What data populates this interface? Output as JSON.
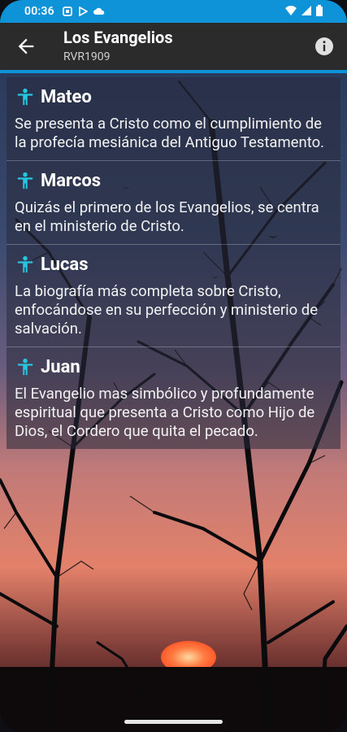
{
  "status": {
    "time": "00:36",
    "left_icons": [
      "card-icon",
      "play-store-icon",
      "cloud-icon"
    ],
    "right_icons": [
      "wifi-icon",
      "signal-icon",
      "battery-icon"
    ]
  },
  "appbar": {
    "title": "Los Evangelios",
    "subtitle": "RVR1909",
    "back_icon": "arrow-left-icon",
    "info_icon": "info-icon"
  },
  "gospels": [
    {
      "name": "Mateo",
      "description": "Se presenta a Cristo como el cumplimiento de la profecía mesiánica del Antiguo Testamento."
    },
    {
      "name": "Marcos",
      "description": "Quizás el primero de los Evangelios, se centra en el ministerio de Cristo."
    },
    {
      "name": "Lucas",
      "description": "La biografía más completa sobre Cristo, enfocándose en su perfección y ministerio de salvación."
    },
    {
      "name": "Juan",
      "description": "El Evangelio mas simbólico y profundamente espiritual que presenta a Cristo como Hijo de Dios, el Cordero que quita el pecado."
    }
  ],
  "colors": {
    "accent": "#0f93d8",
    "appbar": "#2b2b2b",
    "person_icon": "#26c6e0"
  }
}
